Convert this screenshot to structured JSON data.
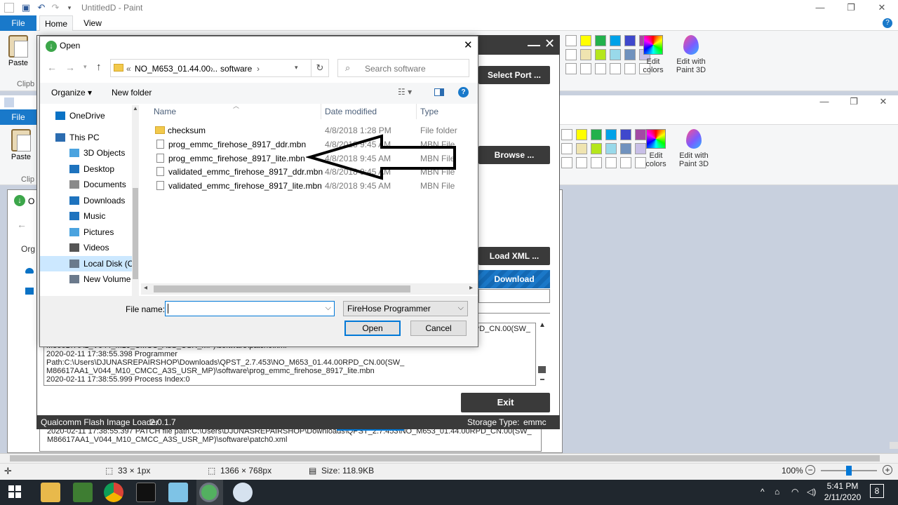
{
  "paint": {
    "title": "UntitledD - Paint",
    "tabs": [
      "File",
      "Home",
      "View"
    ],
    "paste_label": "Paste",
    "clipboard_label": "Clipb",
    "clipboard_label2": "Clip",
    "edit_colors": [
      "Edit",
      "colors"
    ],
    "edit_paint3d": [
      "Edit with",
      "Paint 3D"
    ],
    "status": {
      "selection": "33 × 1px",
      "dimensions": "1366 × 768px",
      "size": "Size: 118.9KB",
      "zoom": "100%"
    },
    "swatch_colors_row1": [
      "#ffff00",
      "#22b14c",
      "#00a2e8",
      "#3f48cc",
      "#a349a4"
    ],
    "swatch_colors_row2": [
      "#efe4b0",
      "#b5e61d",
      "#99d9ea",
      "#7092be",
      "#c8bfe7"
    ],
    "inner_tab_file": "File",
    "inner_dialog_letter": "O",
    "inner_org": "Org"
  },
  "qfil": {
    "buttons": {
      "select_port": "Select Port ...",
      "browse": "Browse ...",
      "load_xml": "Load XML ...",
      "download": "Download",
      "exit": "Exit"
    },
    "log_lines": [
      "RPD_CN.00(SW_",
      "M86617AA1_V044_M10_CMCC_A3S_USR_MP)\\software\\patch0.xml",
      "2020-02-11 17:38:55.398    Programmer Path:C:\\Users\\DJUNASREPAIRSHOP\\Downloads\\QPST_2.7.453\\NO_M653_01.44.00RPD_CN.00(SW_",
      "M86617AA1_V044_M10_CMCC_A3S_USR_MP)\\software\\prog_emmc_firehose_8917_lite.mbn",
      "2020-02-11 17:38:55.999    Process Index:0"
    ],
    "inner_log_lines": [
      "2020-02-11 17:38:55.397    PATCH file path:C:\\Users\\DJUNASREPAIRSHOP\\Downloads\\QPST_2.7.453\\NO_M653_01.44.00RPD_CN.00(SW_",
      "M86617AA1_V044_M10_CMCC_A3S_USR_MP)\\software\\patch0.xml"
    ],
    "status_app": "Qualcomm Flash Image Loader",
    "status_version": "2.0.1.7",
    "storage_label": "Storage Type:",
    "storage_value": "emmc"
  },
  "dialog": {
    "title": "Open",
    "breadcrumb": [
      "«",
      "NO_M653_01.44.00...",
      "›",
      "software",
      "›"
    ],
    "search_placeholder": "Search software",
    "organize": "Organize ▾",
    "new_folder": "New folder",
    "tree": [
      {
        "label": "OneDrive",
        "icon": "cloud-icon"
      },
      {
        "label": "This PC",
        "icon": "computer-icon"
      },
      {
        "label": "3D Objects",
        "icon": "cube-icon"
      },
      {
        "label": "Desktop",
        "icon": "desktop-icon"
      },
      {
        "label": "Documents",
        "icon": "documents-icon"
      },
      {
        "label": "Downloads",
        "icon": "downloads-icon"
      },
      {
        "label": "Music",
        "icon": "music-icon"
      },
      {
        "label": "Pictures",
        "icon": "pictures-icon"
      },
      {
        "label": "Videos",
        "icon": "videos-icon"
      },
      {
        "label": "Local Disk (C:)",
        "icon": "disk-icon"
      },
      {
        "label": "New Volume (E:",
        "icon": "drive-icon"
      }
    ],
    "columns": {
      "name": "Name",
      "date": "Date modified",
      "type": "Type"
    },
    "files": [
      {
        "name": "checksum",
        "date": "4/8/2018 1:28 PM",
        "type": "File folder",
        "kind": "folder"
      },
      {
        "name": "prog_emmc_firehose_8917_ddr.mbn",
        "date": "4/8/2018 9:45 AM",
        "type": "MBN File",
        "kind": "file"
      },
      {
        "name": "prog_emmc_firehose_8917_lite.mbn",
        "date": "4/8/2018 9:45 AM",
        "type": "MBN File",
        "kind": "file"
      },
      {
        "name": "validated_emmc_firehose_8917_ddr.mbn",
        "date": "4/8/2018 9:45 AM",
        "type": "MBN File",
        "kind": "file"
      },
      {
        "name": "validated_emmc_firehose_8917_lite.mbn",
        "date": "4/8/2018 9:45 AM",
        "type": "MBN File",
        "kind": "file"
      }
    ],
    "filename_label": "File name:",
    "filename_value": "",
    "filter": "FireHose Programmer",
    "open_btn": "Open",
    "cancel_btn": "Cancel"
  },
  "taskbar": {
    "time": "5:41 PM",
    "date": "2/11/2020",
    "notifications": "8"
  }
}
